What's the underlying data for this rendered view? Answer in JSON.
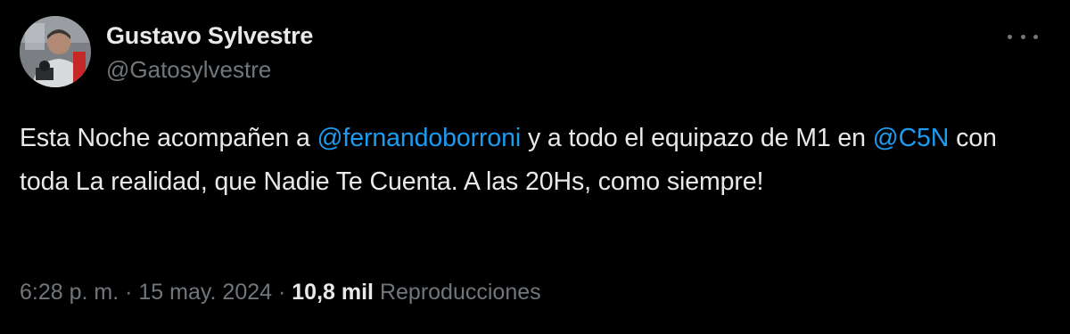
{
  "author": {
    "display_name": "Gustavo Sylvestre",
    "handle": "@Gatosylvestre"
  },
  "menu": {
    "icon": "more-horizontal-icon"
  },
  "tweet": {
    "part1": "Esta Noche acompañen a ",
    "mention1": "@fernandoborroni",
    "part2": " y a todo el equipazo de M1 en ",
    "mention2": "@C5N",
    "part3": " con toda La realidad, que Nadie Te Cuenta. A las 20Hs, como siempre!"
  },
  "meta": {
    "time": "6:28 p. m.",
    "separator": "·",
    "date": "15 may. 2024",
    "views_count": "10,8 mil",
    "views_label": "Reproducciones"
  },
  "colors": {
    "background": "#000000",
    "text_primary": "#e7e9ea",
    "text_secondary": "#71767b",
    "link": "#1d9bf0"
  }
}
